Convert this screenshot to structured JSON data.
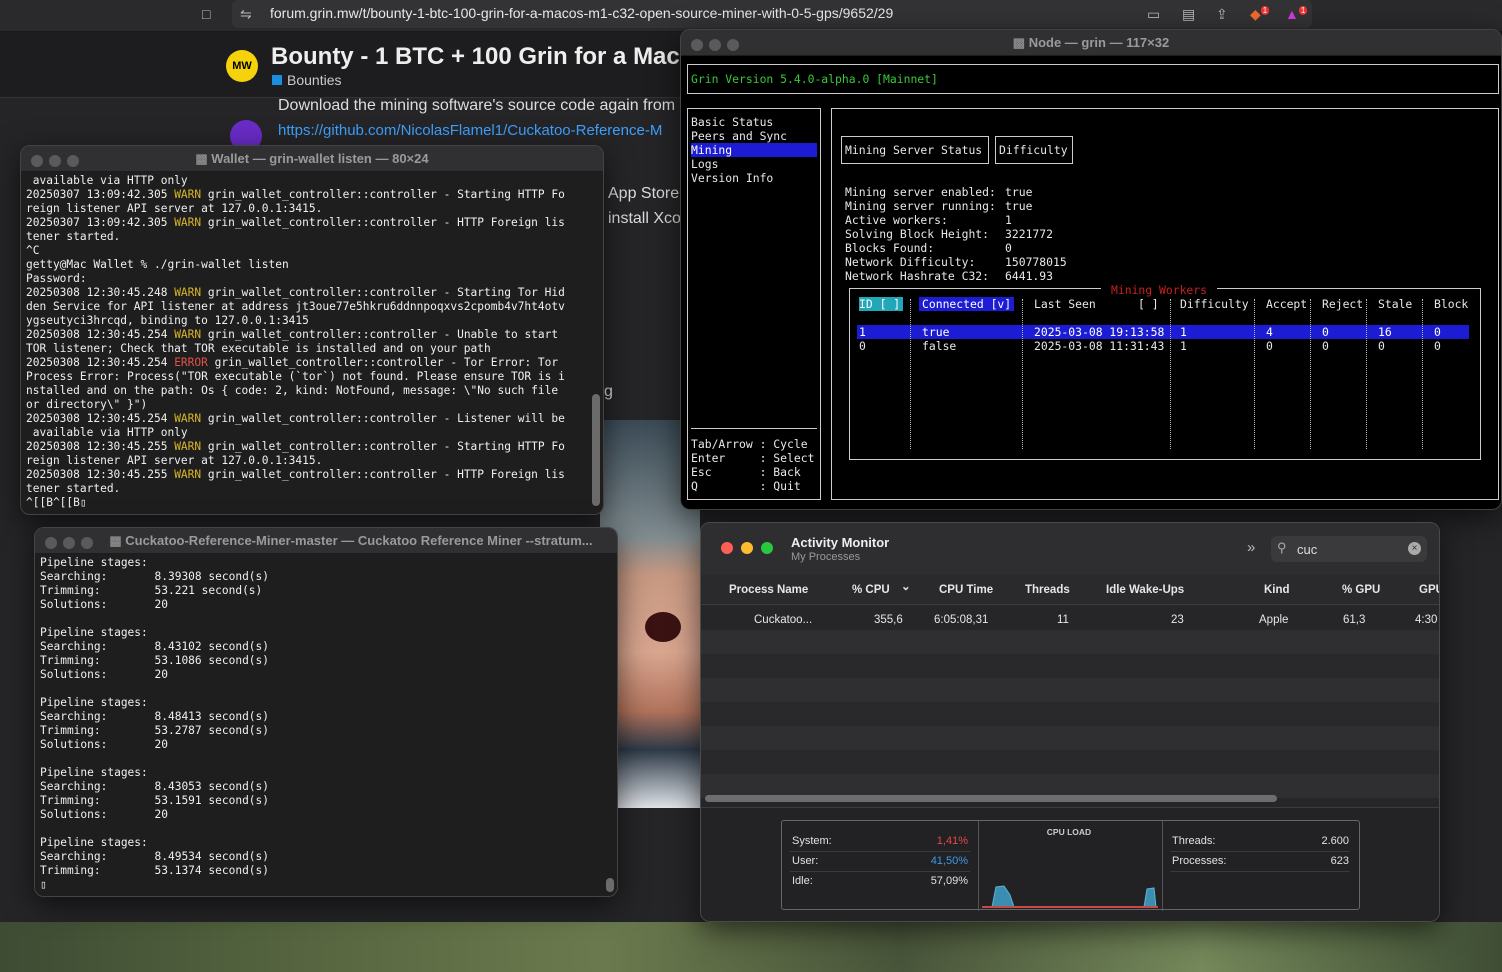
{
  "browser": {
    "url": "forum.grin.mw/t/bounty-1-btc-100-grin-for-a-macos-m1-c32-open-source-miner-with-0-5-gps/9652/29",
    "brave_badge": "1",
    "alert_badge": "1"
  },
  "forum": {
    "logo_text": "MW",
    "title": "Bounty - 1 BTC + 100 Grin for a Mac",
    "category": "Bounties",
    "line1": "Download the mining software's source code again from",
    "link": "https://github.com/NicolasFlamel1/Cuckatoo-Reference-M",
    "frag_appstore": "App Store",
    "frag_xcode": "install Xco",
    "frag_g": "g"
  },
  "wallet": {
    "title": "Wallet — grin-wallet listen — 80×24",
    "lines": [
      [
        {
          "t": " available via HTTP only"
        }
      ],
      [
        {
          "t": "20250307 13:09:42.305 "
        },
        {
          "t": "WARN",
          "c": "warn"
        },
        {
          "t": " grin_wallet_controller::controller - Starting HTTP Fo"
        }
      ],
      [
        {
          "t": "reign listener API server at 127.0.0.1:3415."
        }
      ],
      [
        {
          "t": "20250307 13:09:42.305 "
        },
        {
          "t": "WARN",
          "c": "warn"
        },
        {
          "t": " grin_wallet_controller::controller - HTTP Foreign lis"
        }
      ],
      [
        {
          "t": "tener started."
        }
      ],
      [
        {
          "t": "^C"
        }
      ],
      [
        {
          "t": "getty@Mac Wallet % ./grin-wallet listen"
        }
      ],
      [
        {
          "t": "Password:"
        }
      ],
      [
        {
          "t": "20250308 12:30:45.248 "
        },
        {
          "t": "WARN",
          "c": "warn"
        },
        {
          "t": " grin_wallet_controller::controller - Starting Tor Hid"
        }
      ],
      [
        {
          "t": "den Service for API listener at address jt3oue77e5hkru6ddnnpoqxvs2cpomb4v7ht4otv"
        }
      ],
      [
        {
          "t": "ygseutyci3hrcqd, binding to 127.0.0.1:3415"
        }
      ],
      [
        {
          "t": "20250308 12:30:45.254 "
        },
        {
          "t": "WARN",
          "c": "warn"
        },
        {
          "t": " grin_wallet_controller::controller - Unable to start"
        }
      ],
      [
        {
          "t": "TOR listener; Check that TOR executable is installed and on your path"
        }
      ],
      [
        {
          "t": "20250308 12:30:45.254 "
        },
        {
          "t": "ERROR",
          "c": "err"
        },
        {
          "t": " grin_wallet_controller::controller - Tor Error: Tor"
        }
      ],
      [
        {
          "t": "Process Error: Process(\"TOR executable (`tor`) not found. Please ensure TOR is i"
        }
      ],
      [
        {
          "t": "nstalled and on the path: Os { code: 2, kind: NotFound, message: \\\"No such file"
        }
      ],
      [
        {
          "t": "or directory\\\" }\")"
        }
      ],
      [
        {
          "t": "20250308 12:30:45.254 "
        },
        {
          "t": "WARN",
          "c": "warn"
        },
        {
          "t": " grin_wallet_controller::controller - Listener will be"
        }
      ],
      [
        {
          "t": " available via HTTP only"
        }
      ],
      [
        {
          "t": "20250308 12:30:45.255 "
        },
        {
          "t": "WARN",
          "c": "warn"
        },
        {
          "t": " grin_wallet_controller::controller - Starting HTTP Fo"
        }
      ],
      [
        {
          "t": "reign listener API server at 127.0.0.1:3415."
        }
      ],
      [
        {
          "t": "20250308 12:30:45.255 "
        },
        {
          "t": "WARN",
          "c": "warn"
        },
        {
          "t": " grin_wallet_controller::controller - HTTP Foreign lis"
        }
      ],
      [
        {
          "t": "tener started."
        }
      ],
      [
        {
          "t": "^[[B^[[B▯"
        }
      ]
    ]
  },
  "miner": {
    "title": "Cuckatoo-Reference-Miner-master — Cuckatoo Reference Miner --stratum...",
    "lines": [
      "Pipeline stages:",
      "Searching:       8.39308 second(s)",
      "Trimming:        53.221 second(s)",
      "Solutions:       20",
      "",
      "Pipeline stages:",
      "Searching:       8.43102 second(s)",
      "Trimming:        53.1086 second(s)",
      "Solutions:       20",
      "",
      "Pipeline stages:",
      "Searching:       8.48413 second(s)",
      "Trimming:        53.2787 second(s)",
      "Solutions:       20",
      "",
      "Pipeline stages:",
      "Searching:       8.43053 second(s)",
      "Trimming:        53.1591 second(s)",
      "Solutions:       20",
      "",
      "Pipeline stages:",
      "Searching:       8.49534 second(s)",
      "Trimming:        53.1374 second(s)",
      "▯"
    ]
  },
  "node": {
    "title": "Node — grin — 117×32",
    "version": "Grin Version 5.4.0-alpha.0 [Mainnet]",
    "menu": [
      "Basic Status",
      "Peers and Sync",
      "Mining",
      "Logs",
      "Version Info"
    ],
    "help": [
      "Tab/Arrow : Cycle",
      "Enter     : Select",
      "Esc       : Back",
      "Q         : Quit"
    ],
    "tabs": [
      "Mining Server Status",
      "Difficulty"
    ],
    "status": [
      {
        "label": "Mining server enabled:",
        "value": "true"
      },
      {
        "label": "Mining server running:",
        "value": "true"
      },
      {
        "label": "Active workers:",
        "value": "1"
      },
      {
        "label": "Solving Block Height:",
        "value": "3221772"
      },
      {
        "label": "Blocks Found:",
        "value": "0"
      },
      {
        "label": "Network Difficulty:",
        "value": "150778015"
      },
      {
        "label": "Network Hashrate C32:",
        "value": "6441.93"
      }
    ],
    "workers_title": "Mining Workers",
    "columns": [
      "ID [ ]",
      "Connected [v]",
      "Last Seen",
      "[ ]",
      "Difficulty",
      "Accept",
      "Reject",
      "Stale",
      "Block"
    ],
    "rows": [
      [
        "1",
        "true",
        "2025-03-08 19:13:58",
        "1",
        "4",
        "0",
        "16",
        "0"
      ],
      [
        "0",
        "false",
        "2025-03-08 11:31:43",
        "1",
        "0",
        "0",
        "0",
        "0"
      ]
    ]
  },
  "activity": {
    "title": "Activity Monitor",
    "subtitle": "My Processes",
    "search": "cuc",
    "columns": [
      "Process Name",
      "% CPU",
      "CPU Time",
      "Threads",
      "Idle Wake-Ups",
      "Kind",
      "% GPU",
      "GPU"
    ],
    "row": [
      "Cuckatoo...",
      "355,6",
      "6:05:08,31",
      "11",
      "23",
      "Apple",
      "61,3",
      "4:30"
    ],
    "system_label": "System:",
    "system_value": "1,41%",
    "user_label": "User:",
    "user_value": "41,50%",
    "idle_label": "Idle:",
    "idle_value": "57,09%",
    "cpu_load_label": "CPU LOAD",
    "threads_label": "Threads:",
    "threads_value": "2.600",
    "processes_label": "Processes:",
    "processes_value": "623"
  },
  "colors": {
    "warn": "#d6b52a",
    "error": "#e2504c",
    "grin_green": "#39c83b",
    "select_blue": "#1c1cd4",
    "system_red": "#e24a47",
    "user_blue": "#3d9ae8"
  }
}
